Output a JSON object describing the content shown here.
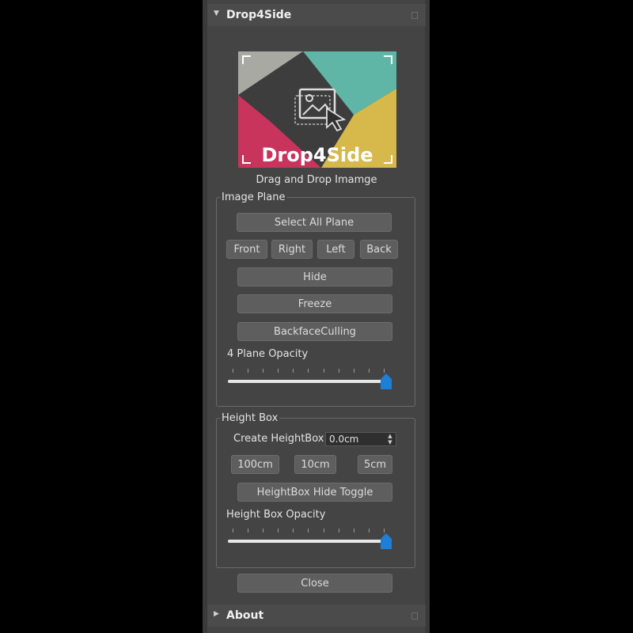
{
  "main_rollout": {
    "title": "Drop4Side",
    "expanded": true
  },
  "logo": {
    "text": "Drop4Side",
    "colors": [
      "#a9a9a4",
      "#5fb5a6",
      "#c9345d",
      "#d6b94a",
      "#3b3b3b"
    ]
  },
  "drop_caption": "Drag and Drop Imamge",
  "image_plane": {
    "legend": "Image Plane",
    "select_all": "Select All Plane",
    "views": [
      "Front",
      "Right",
      "Left",
      "Back"
    ],
    "hide": "Hide",
    "freeze": "Freeze",
    "backface": "BackfaceCulling",
    "opacity_label": "4 Plane Opacity",
    "opacity_value": 1.0
  },
  "height_box": {
    "legend": "Height Box",
    "create_label": "Create HeightBox",
    "create_value": "0.0cm",
    "sizes": [
      "100cm",
      "10cm",
      "5cm"
    ],
    "toggle": "HeightBox Hide Toggle",
    "opacity_label": "Height Box Opacity",
    "opacity_value": 1.0
  },
  "close_label": "Close",
  "about_rollout": {
    "title": "About",
    "expanded": false
  },
  "accent_color": "#1e7fd6"
}
